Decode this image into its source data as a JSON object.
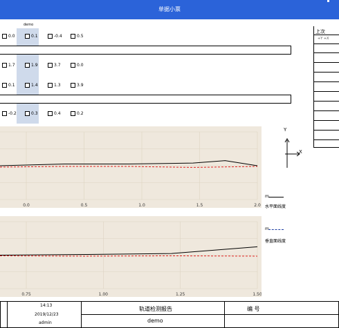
{
  "window": {
    "title": "单据小票"
  },
  "header": {
    "column_label": "demo"
  },
  "rows": [
    {
      "values": [
        "0.0",
        "0.1",
        "-0.4",
        "0.5"
      ]
    },
    {
      "values": [
        "1.7",
        "1.9",
        "3.7",
        "0.0"
      ]
    },
    {
      "values": [
        "0.1",
        "1.4",
        "1.3",
        "3.9"
      ]
    },
    {
      "values": [
        "-0.2",
        "0.3",
        "0.4",
        "0.2"
      ]
    }
  ],
  "side_table": {
    "title": "上次",
    "subheader": "+Y  +X"
  },
  "axis_indicator": {
    "y_label": "Y",
    "x_label": "X"
  },
  "chart_data": [
    {
      "type": "line",
      "x_ticks": [
        "0.0",
        "0.5",
        "1.0",
        "1.5",
        "2.0"
      ],
      "xlim": [
        0.0,
        2.0
      ],
      "ylim": [
        -1.0,
        1.0
      ],
      "series": [
        {
          "name": "",
          "color": "#000000",
          "x": [
            0.0,
            0.5,
            1.0,
            1.5,
            1.75,
            2.0
          ],
          "y": [
            0.0,
            0.05,
            0.05,
            0.08,
            0.15,
            0.0
          ]
        },
        {
          "name": "",
          "color": "#e02020",
          "x": [
            0.0,
            0.5,
            1.0,
            1.5,
            2.0
          ],
          "y": [
            -0.04,
            -0.02,
            -0.02,
            -0.05,
            -0.02
          ]
        }
      ]
    },
    {
      "type": "line",
      "x_ticks": [
        "0.75",
        "1.00",
        "1.25",
        "1.50"
      ],
      "xlim": [
        0.6,
        1.5
      ],
      "ylim": [
        -1.0,
        1.0
      ],
      "series": [
        {
          "name": "",
          "color": "#000000",
          "x": [
            0.6,
            0.9,
            1.2,
            1.5
          ],
          "y": [
            0.0,
            0.02,
            0.05,
            0.25
          ]
        },
        {
          "name": "",
          "color": "#e02020",
          "x": [
            0.6,
            0.9,
            1.2,
            1.5
          ],
          "y": [
            -0.02,
            -0.03,
            -0.02,
            -0.03
          ]
        }
      ]
    }
  ],
  "legend": {
    "top": {
      "label1": "m",
      "label2": "水平面线度"
    },
    "bottom": {
      "label1": "m",
      "label2": "垂直面线度"
    }
  },
  "footer": {
    "row1": "14:13",
    "row2": "2019/12/23",
    "row3": "admin",
    "report_title": "轨道检测报告",
    "report_sub": "demo",
    "code_label": "编  号"
  }
}
